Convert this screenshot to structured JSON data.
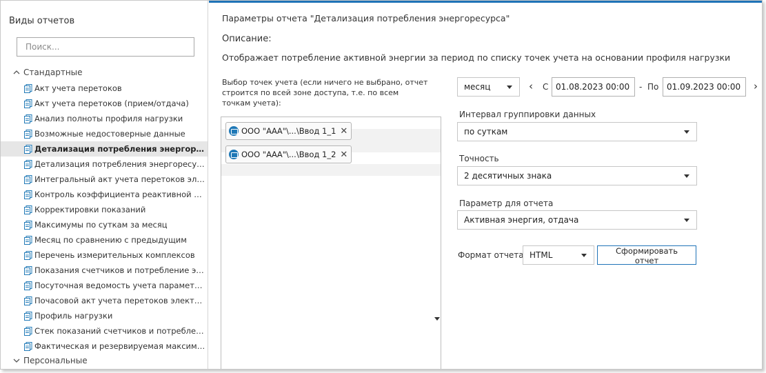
{
  "sidebar": {
    "title": "Виды отчетов",
    "search_placeholder": "Поиск...",
    "groups": [
      {
        "label": "Стандартные",
        "expanded": true
      },
      {
        "label": "Персональные",
        "expanded": false
      }
    ],
    "items": [
      {
        "label": "Акт учета перетоков"
      },
      {
        "label": "Акт учета перетоков (прием/отдача)"
      },
      {
        "label": "Анализ полноты профиля нагрузки"
      },
      {
        "label": "Возможные недостоверные данные"
      },
      {
        "label": "Детализация потребления энергоресурса",
        "active": true
      },
      {
        "label": "Детализация потребления энергоресурса ..."
      },
      {
        "label": "Интегральный акт учета перетоков электр..."
      },
      {
        "label": "Контроль коэффициента реактивной мощ..."
      },
      {
        "label": "Корректировки показаний"
      },
      {
        "label": "Максимумы по суткам за месяц"
      },
      {
        "label": "Месяц по сравнению с предыдущим"
      },
      {
        "label": "Перечень измерительных комплексов"
      },
      {
        "label": "Показания счетчиков и потребление энер..."
      },
      {
        "label": "Посуточная ведомость учета параметров ..."
      },
      {
        "label": "Почасовой акт учета перетоков электриче..."
      },
      {
        "label": "Профиль нагрузки"
      },
      {
        "label": "Стек показаний счетчиков и потребление ..."
      },
      {
        "label": "Фактическая и резервируемая максималь..."
      }
    ]
  },
  "main": {
    "title": "Параметры отчета \"Детализация потребления энергоресурса\"",
    "description_label": "Описание:",
    "description": "Отображает потребление активной энергии за период по списку точек учета на основании профиля нагрузки",
    "points_label": "Выбор точек учета (если ничего не выбрано, отчет строится по всей зоне доступа, т.е. по всем точкам учета):",
    "points": [
      {
        "label": "ООО \"ААА\"\\...\\Ввод 1_1"
      },
      {
        "label": "ООО \"ААА\"\\...\\Ввод 1_2"
      }
    ],
    "period": {
      "unit": "месяц",
      "from_label": "С",
      "from_value": "01.08.2023 00:00",
      "separator": "-",
      "to_label": "По",
      "to_value": "01.09.2023 00:00"
    },
    "grouping": {
      "label": "Интервал группировки данных",
      "value": "по суткам"
    },
    "precision": {
      "label": "Точность",
      "value": "2 десятичных знака"
    },
    "parameter": {
      "label": "Параметр для отчета",
      "value": "Активная энергия, отдача"
    },
    "format": {
      "label": "Формат отчета:",
      "value": "HTML"
    },
    "generate_button": "Сформировать отчет"
  },
  "colors": {
    "accent": "#1f73b7",
    "active_row": "#e6e6e6",
    "meter_icon": "#1e78b6"
  },
  "icons": {
    "report_item": "document-icon",
    "point_chip": "meter-icon",
    "chip_remove": "close-icon",
    "group_expanded": "chevron-up-icon",
    "group_collapsed": "chevron-down-icon"
  }
}
